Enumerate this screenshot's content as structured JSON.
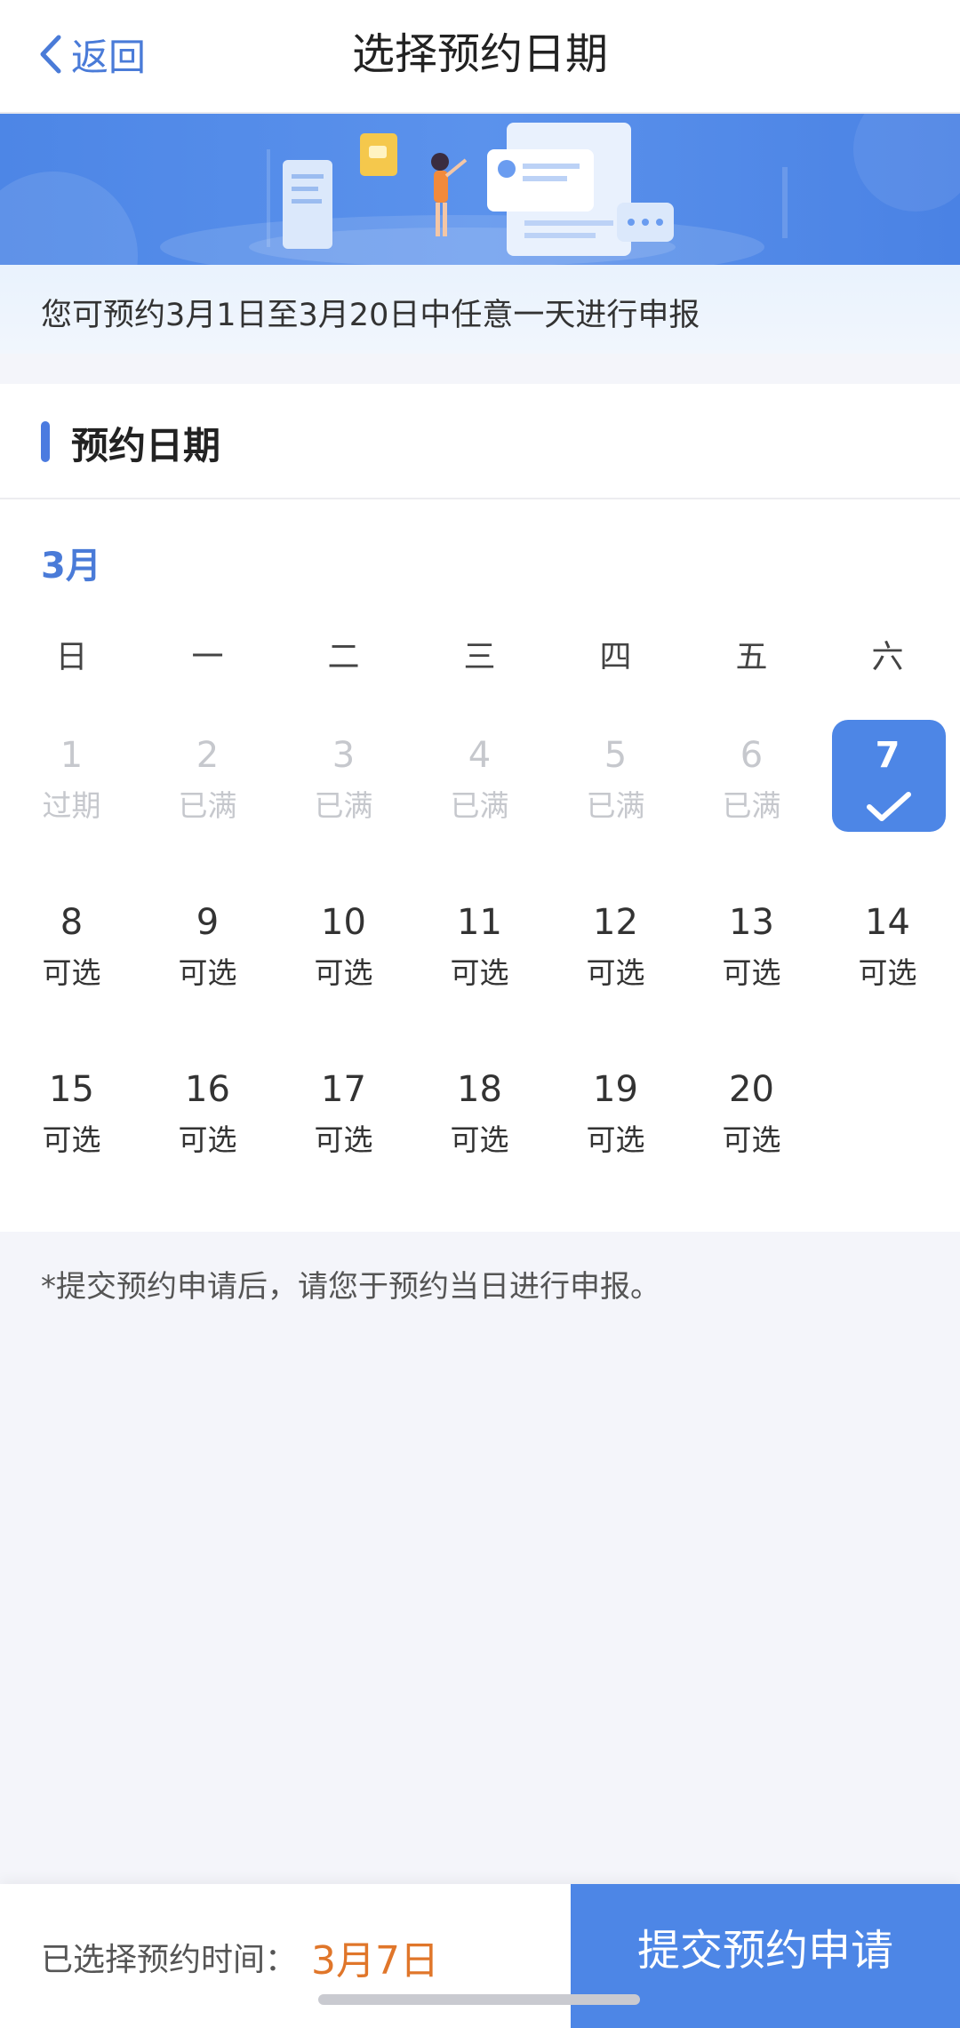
{
  "header": {
    "back_label": "返回",
    "title": "选择预约日期"
  },
  "notice": "您可预约3月1日至3月20日中任意一天进行申报",
  "section_title": "预约日期",
  "calendar": {
    "month": "3月",
    "weekdays": [
      "日",
      "一",
      "二",
      "三",
      "四",
      "五",
      "六"
    ],
    "days": [
      {
        "num": "1",
        "status": "过期",
        "state": "expired"
      },
      {
        "num": "2",
        "status": "已满",
        "state": "full"
      },
      {
        "num": "3",
        "status": "已满",
        "state": "full"
      },
      {
        "num": "4",
        "status": "已满",
        "state": "full"
      },
      {
        "num": "5",
        "status": "已满",
        "state": "full"
      },
      {
        "num": "6",
        "status": "已满",
        "state": "full"
      },
      {
        "num": "7",
        "status": "",
        "state": "selected"
      },
      {
        "num": "8",
        "status": "可选",
        "state": "avail"
      },
      {
        "num": "9",
        "status": "可选",
        "state": "avail"
      },
      {
        "num": "10",
        "status": "可选",
        "state": "avail"
      },
      {
        "num": "11",
        "status": "可选",
        "state": "avail"
      },
      {
        "num": "12",
        "status": "可选",
        "state": "avail"
      },
      {
        "num": "13",
        "status": "可选",
        "state": "avail"
      },
      {
        "num": "14",
        "status": "可选",
        "state": "avail"
      },
      {
        "num": "15",
        "status": "可选",
        "state": "avail"
      },
      {
        "num": "16",
        "status": "可选",
        "state": "avail"
      },
      {
        "num": "17",
        "status": "可选",
        "state": "avail"
      },
      {
        "num": "18",
        "status": "可选",
        "state": "avail"
      },
      {
        "num": "19",
        "status": "可选",
        "state": "avail"
      },
      {
        "num": "20",
        "status": "可选",
        "state": "avail"
      }
    ]
  },
  "note": "*提交预约申请后，请您于预约当日进行申报。",
  "footer": {
    "selected_label": "已选择预约时间：",
    "selected_value": "3月7日",
    "submit_label": "提交预约申请"
  },
  "colors": {
    "accent": "#4d86e6",
    "selected_date_text": "#e0762a"
  }
}
